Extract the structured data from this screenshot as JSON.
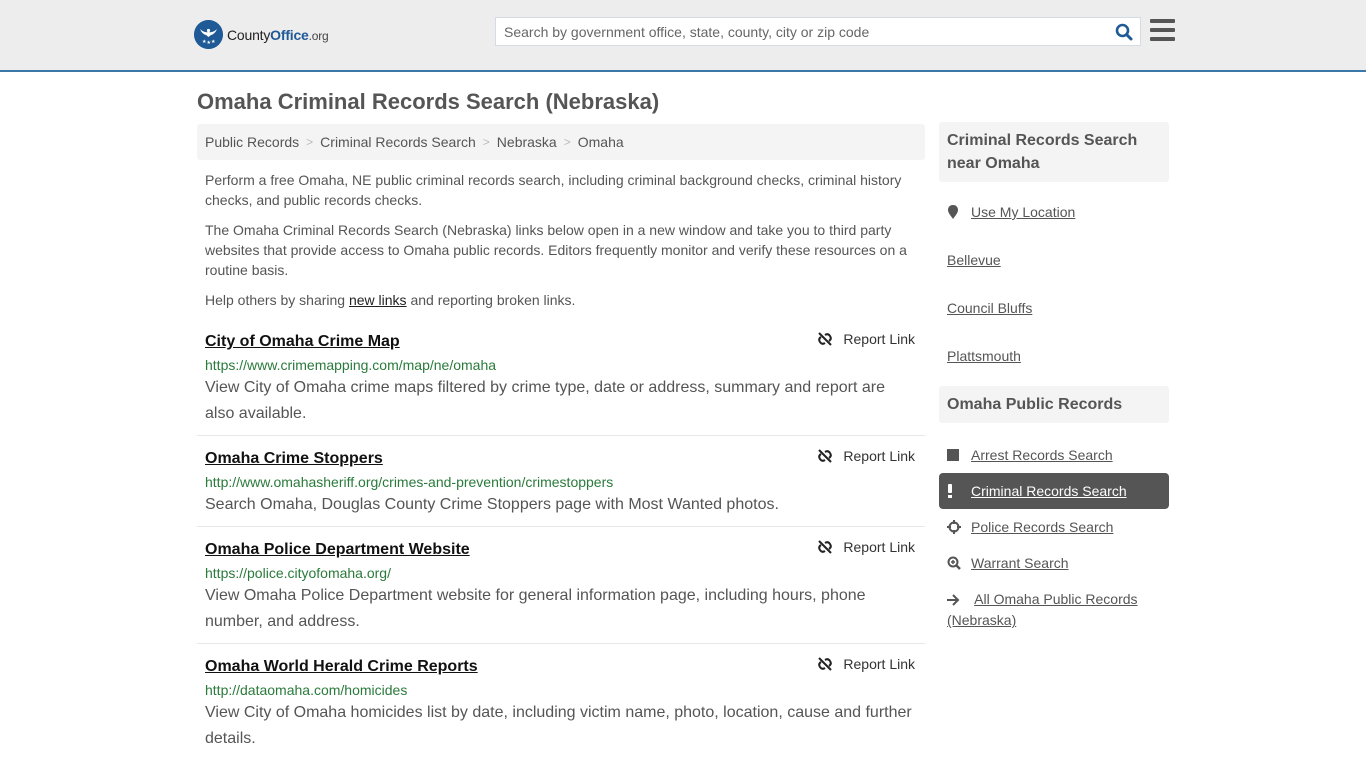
{
  "header": {
    "logo": {
      "name_part1": "County",
      "name_part2": "Office",
      "tld": ".org"
    },
    "search": {
      "placeholder": "Search by government office, state, county, city or zip code",
      "value": ""
    },
    "colors": {
      "brand": "#1f5a96",
      "header_border": "#3b78a8"
    }
  },
  "page": {
    "title": "Omaha Criminal Records Search (Nebraska)",
    "breadcrumb": [
      {
        "label": "Public Records"
      },
      {
        "label": "Criminal Records Search"
      },
      {
        "label": "Nebraska"
      },
      {
        "label": "Omaha"
      }
    ],
    "breadcrumb_separator": ">",
    "intro": {
      "p1": "Perform a free Omaha, NE public criminal records search, including criminal background checks, criminal history checks, and public records checks.",
      "p2": "The Omaha Criminal Records Search (Nebraska) links below open in a new window and take you to third party websites that provide access to Omaha public records. Editors frequently monitor and verify these resources on a routine basis.",
      "p3_before": "Help others by sharing ",
      "p3_link": "new links",
      "p3_after": " and reporting broken links."
    },
    "report_label": "Report Link",
    "results": [
      {
        "title": "City of Omaha Crime Map",
        "url": "https://www.crimemapping.com/map/ne/omaha",
        "description": "View City of Omaha crime maps filtered by crime type, date or address, summary and report are also available."
      },
      {
        "title": "Omaha Crime Stoppers",
        "url": "http://www.omahasheriff.org/crimes-and-prevention/crimestoppers",
        "description": "Search Omaha, Douglas County Crime Stoppers page with Most Wanted photos."
      },
      {
        "title": "Omaha Police Department Website",
        "url": "https://police.cityofomaha.org/",
        "description": "View Omaha Police Department website for general information page, including hours, phone number, and address."
      },
      {
        "title": "Omaha World Herald Crime Reports",
        "url": "http://dataomaha.com/homicides",
        "description": "View City of Omaha homicides list by date, including victim name, photo, location, cause and further details."
      }
    ]
  },
  "sidebar": {
    "nearby": {
      "heading": "Criminal Records Search near Omaha",
      "use_location": {
        "label": "Use My Location",
        "icon": "map-marker-icon"
      },
      "cities": [
        {
          "label": "Bellevue"
        },
        {
          "label": "Council Bluffs"
        },
        {
          "label": "Plattsmouth"
        }
      ]
    },
    "public_records": {
      "heading": "Omaha Public Records",
      "items": [
        {
          "label": "Arrest Records Search",
          "icon": "square-icon",
          "active": false
        },
        {
          "label": "Criminal Records Search",
          "icon": "exclamation-icon",
          "active": true
        },
        {
          "label": "Police Records Search",
          "icon": "crosshairs-icon",
          "active": false
        },
        {
          "label": "Warrant Search",
          "icon": "search-plus-icon",
          "active": false
        },
        {
          "label": "All Omaha Public Records (Nebraska)",
          "icon": "arrow-right-icon",
          "active": false
        }
      ]
    }
  }
}
